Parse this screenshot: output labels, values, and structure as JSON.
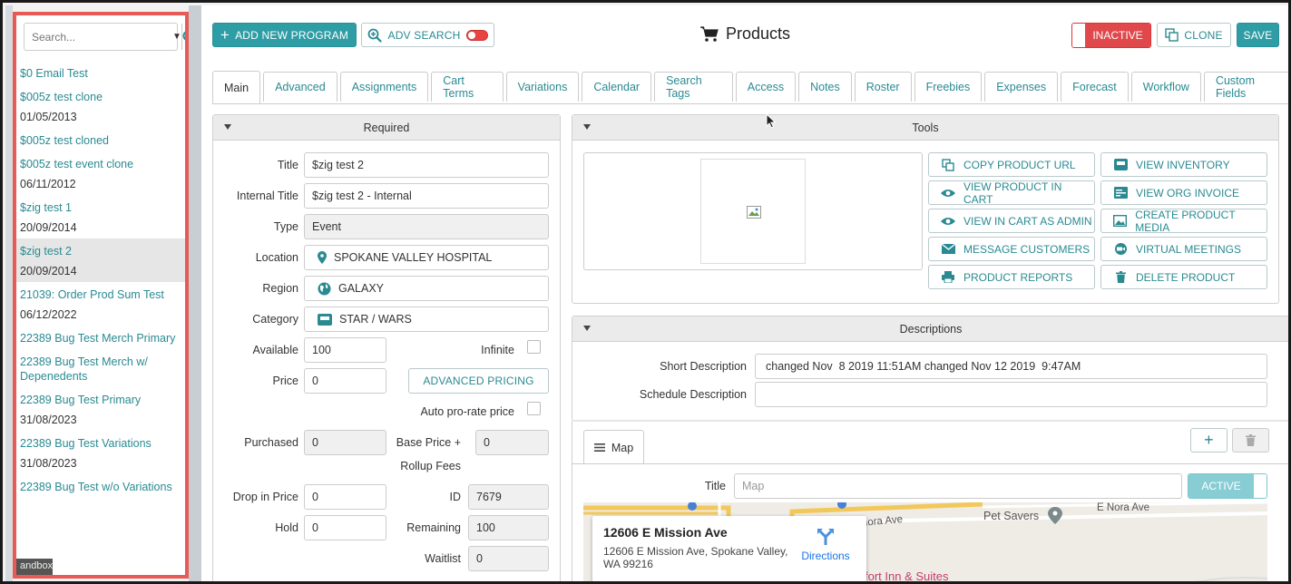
{
  "sidebar": {
    "search_placeholder": "Search...",
    "items": [
      {
        "name": "$0 Email Test",
        "date": ""
      },
      {
        "name": "$005z test clone",
        "date": "01/05/2013"
      },
      {
        "name": "$005z test cloned",
        "date": ""
      },
      {
        "name": "$005z test event clone",
        "date": "06/11/2012"
      },
      {
        "name": "$zig test 1",
        "date": "20/09/2014"
      },
      {
        "name": "$zig test 2",
        "date": "20/09/2014",
        "selected": true
      },
      {
        "name": "21039: Order Prod Sum Test",
        "date": "06/12/2022"
      },
      {
        "name": "22389 Bug Test Merch Primary",
        "date": ""
      },
      {
        "name": "22389 Bug Test Merch w/ Depenedents",
        "date": ""
      },
      {
        "name": "22389 Bug Test Primary",
        "date": "31/08/2023"
      },
      {
        "name": "22389 Bug Test Variations",
        "date": "31/08/2023"
      },
      {
        "name": "22389 Bug Test w/o Variations",
        "date": ""
      }
    ],
    "footer_label": "andbox"
  },
  "toolbar": {
    "add_new_program": "ADD NEW PROGRAM",
    "adv_search": "ADV SEARCH",
    "page_title": "Products",
    "inactive": "INACTIVE",
    "clone": "CLONE",
    "save": "SAVE"
  },
  "tabs": [
    "Main",
    "Advanced",
    "Assignments",
    "Cart Terms",
    "Variations",
    "Calendar",
    "Search Tags",
    "Access",
    "Notes",
    "Roster",
    "Freebies",
    "Expenses",
    "Forecast",
    "Workflow",
    "Custom Fields"
  ],
  "required": {
    "heading": "Required",
    "title_label": "Title",
    "title_value": "$zig test 2",
    "internal_title_label": "Internal Title",
    "internal_title_value": "$zig test 2 - Internal",
    "type_label": "Type",
    "type_value": "Event",
    "location_label": "Location",
    "location_value": "SPOKANE VALLEY HOSPITAL",
    "region_label": "Region",
    "region_value": "GALAXY",
    "category_label": "Category",
    "category_value": "STAR / WARS",
    "available_label": "Available",
    "available_value": "100",
    "infinite_label": "Infinite",
    "price_label": "Price",
    "price_value": "0",
    "advanced_pricing": "ADVANCED PRICING",
    "auto_prorate_label": "Auto pro-rate price",
    "purchased_label": "Purchased",
    "purchased_value": "0",
    "base_price_label_1": "Base Price +",
    "base_price_label_2": "Rollup Fees",
    "base_price_value": "0",
    "drop_label": "Drop in Price",
    "drop_value": "0",
    "id_label": "ID",
    "id_value": "7679",
    "hold_label": "Hold",
    "hold_value": "0",
    "remaining_label": "Remaining",
    "remaining_value": "100",
    "waitlist_label": "Waitlist",
    "waitlist_value": "0"
  },
  "tools": {
    "heading": "Tools",
    "buttons_left": [
      "COPY PRODUCT URL",
      "VIEW PRODUCT IN CART",
      "VIEW IN CART AS ADMIN",
      "MESSAGE CUSTOMERS",
      "PRODUCT REPORTS"
    ],
    "buttons_right": [
      "VIEW INVENTORY",
      "VIEW ORG INVOICE",
      "CREATE PRODUCT MEDIA",
      "VIRTUAL MEETINGS",
      "DELETE PRODUCT"
    ]
  },
  "descriptions": {
    "heading": "Descriptions",
    "short_label": "Short Description",
    "short_value": "changed Nov  8 2019 11:51AM changed Nov 12 2019  9:47AM",
    "schedule_label": "Schedule Description",
    "schedule_value": ""
  },
  "map": {
    "tab_label": "Map",
    "title_label": "Title",
    "title_placeholder": "Map",
    "active_label": "ACTIVE",
    "card_title": "12606 E Mission Ave",
    "card_address_1": "12606 E Mission Ave, Spokane Valley,",
    "card_address_2": "WA 99216",
    "directions": "Directions",
    "poi_1": "Pet Savers",
    "poi_2": "E Nora Ave",
    "poi_3": "Nora Ave",
    "poi_4": "fort Inn & Suites"
  },
  "colors": {
    "accent": "#2e9da5",
    "danger": "#e0484c",
    "sidebar_border": "#e85a55"
  }
}
